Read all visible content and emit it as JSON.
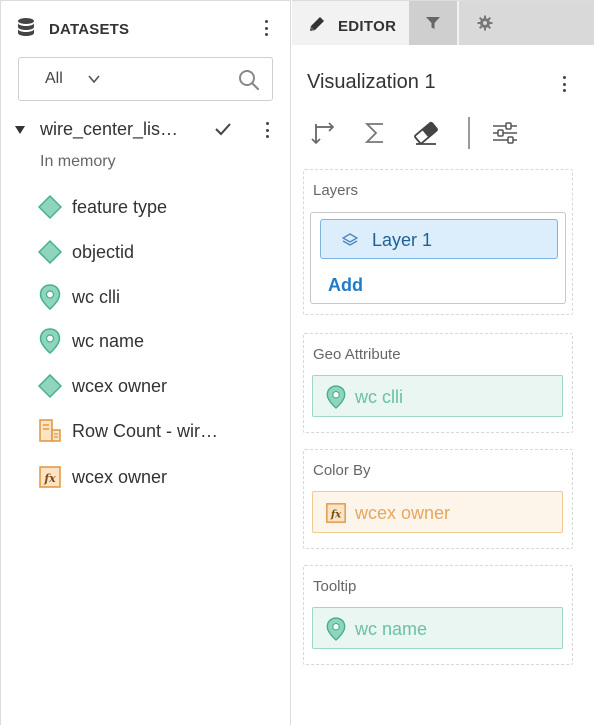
{
  "datasets_panel": {
    "title": "DATASETS",
    "filter": {
      "selected": "All"
    },
    "dataset": {
      "name": "wire_center_lis…",
      "status": "In memory",
      "fields": [
        {
          "label": "feature type",
          "icon": "diamond-field-icon"
        },
        {
          "label": "objectid",
          "icon": "diamond-field-icon"
        },
        {
          "label": "wc clli",
          "icon": "geo-pin-icon"
        },
        {
          "label": "wc name",
          "icon": "geo-pin-icon"
        },
        {
          "label": "wcex owner",
          "icon": "diamond-field-icon"
        },
        {
          "label": "Row Count - wir…",
          "icon": "row-count-icon"
        },
        {
          "label": "wcex owner",
          "icon": "calculated-fx-icon"
        }
      ]
    }
  },
  "editor_panel": {
    "tabs": [
      {
        "label": "EDITOR",
        "icon": "pencil-icon",
        "active": true
      },
      {
        "label": "",
        "icon": "filter-icon",
        "active": false
      },
      {
        "label": "",
        "icon": "gear-icon",
        "active": false
      }
    ],
    "visualization_title": "Visualization 1",
    "toolbar": [
      "axis-type-icon",
      "sigma-icon",
      "eraser-icon",
      "sliders-icon"
    ],
    "layers": {
      "label": "Layers",
      "items": [
        {
          "label": "Layer 1"
        }
      ],
      "add_label": "Add"
    },
    "geo_attribute": {
      "label": "Geo Attribute",
      "value": "wc clli"
    },
    "color_by": {
      "label": "Color By",
      "value": "wcex owner"
    },
    "tooltip": {
      "label": "Tooltip",
      "value": "wc name"
    }
  },
  "colors": {
    "geo_teal": "#4cbc99",
    "calc_orange": "#e8a043",
    "selection_blue": "#1f7bc7"
  }
}
